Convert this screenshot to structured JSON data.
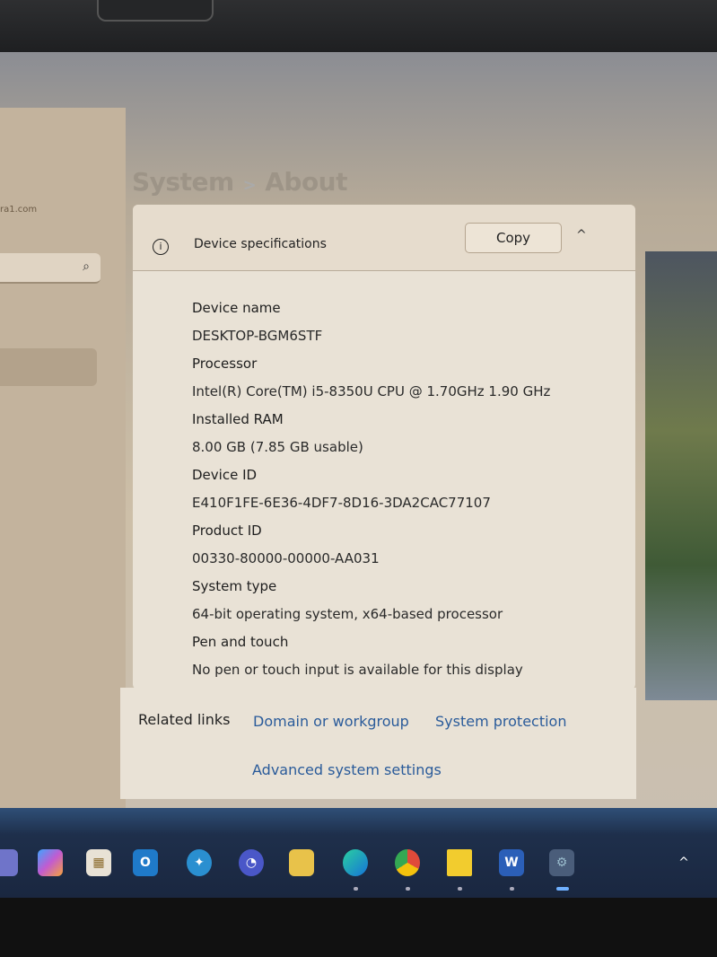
{
  "sidebar": {
    "account_partial": "ra1.com",
    "search_icon": "search-icon"
  },
  "breadcrumb": {
    "parent": "System",
    "separator": ">",
    "current": "About"
  },
  "device_specifications": {
    "title": "Device specifications",
    "copy_label": "Copy",
    "items": [
      {
        "label": "Device name",
        "value": "DESKTOP-BGM6STF"
      },
      {
        "label": "Processor",
        "value": "Intel(R) Core(TM) i5-8350U CPU @ 1.70GHz   1.90 GHz"
      },
      {
        "label": "Installed RAM",
        "value": "8.00 GB (7.85 GB usable)"
      },
      {
        "label": "Device ID",
        "value": "E410F1FE-6E36-4DF7-8D16-3DA2CAC77107"
      },
      {
        "label": "Product ID",
        "value": "00330-80000-00000-AA031"
      },
      {
        "label": "System type",
        "value": "64-bit operating system, x64-based processor"
      },
      {
        "label": "Pen and touch",
        "value": "No pen or touch input is available for this display"
      }
    ]
  },
  "related_links": {
    "label": "Related links",
    "links": [
      "Domain or workgroup",
      "System protection",
      "Advanced system settings"
    ]
  },
  "taskbar": {
    "apps": [
      "teams",
      "copilot",
      "microsoft-store",
      "outlook",
      "app",
      "power-automate",
      "file-explorer",
      "edge",
      "chrome",
      "sticky-notes",
      "word",
      "settings"
    ],
    "tray_chevron": "^"
  }
}
